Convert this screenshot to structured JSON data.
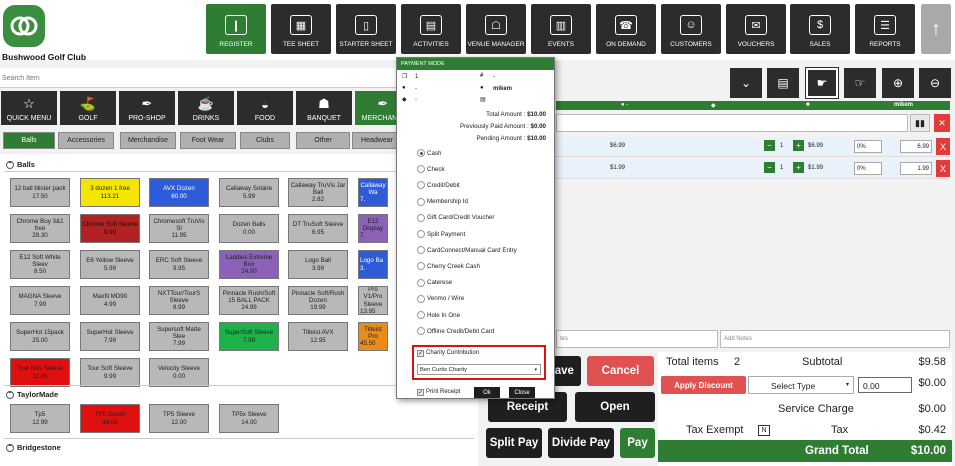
{
  "brand": {
    "name": "Bushwood Golf Club",
    "accent": "#2e7d32"
  },
  "nav": {
    "items": [
      {
        "label": "REGISTER",
        "icon": "barcode-scanner-icon",
        "active": true
      },
      {
        "label": "TEE SHEET",
        "icon": "tee-sheet-icon"
      },
      {
        "label": "STARTER SHEET",
        "icon": "tablet-icon"
      },
      {
        "label": "ACTIVITIES",
        "icon": "calendar-icon"
      },
      {
        "label": "VENUE MANAGER",
        "icon": "venue-icon"
      },
      {
        "label": "EVENTS",
        "icon": "events-calendar-icon"
      },
      {
        "label": "ON DEMAND",
        "icon": "phone-icon"
      },
      {
        "label": "CUSTOMERS",
        "icon": "customers-icon"
      },
      {
        "label": "VOUCHERS",
        "icon": "voucher-icon"
      },
      {
        "label": "SALES",
        "icon": "sales-icon"
      },
      {
        "label": "REPORTS",
        "icon": "reports-icon"
      }
    ]
  },
  "search": {
    "placeholder": "Search Item"
  },
  "categories": [
    {
      "label": "QUICK MENU",
      "icon": "star-icon"
    },
    {
      "label": "GOLF",
      "icon": "golf-icon"
    },
    {
      "label": "PRO-SHOP",
      "icon": "tag-icon"
    },
    {
      "label": "DRINKS",
      "icon": "drink-icon"
    },
    {
      "label": "FOOD",
      "icon": "burger-icon"
    },
    {
      "label": "BANQUET",
      "icon": "banquet-icon"
    },
    {
      "label": "MERCHANDI",
      "icon": "merch-icon",
      "active": true
    }
  ],
  "subcategories": [
    "Balls",
    "Accessories",
    "Merchandise",
    "Foot Wear",
    "Clubs",
    "Other",
    "Headwear"
  ],
  "sections": {
    "balls": "Balls",
    "taylormade": "TaylorMade",
    "bridgestone": "Bridgestone"
  },
  "products": {
    "balls": [
      {
        "name": "12 ball blister pack",
        "price": "17.50",
        "color": "g"
      },
      {
        "name": "3 dozen 1 free",
        "price": "113.21",
        "color": "y"
      },
      {
        "name": "AVX Dozen",
        "price": "60.00",
        "color": "b"
      },
      {
        "name": "Callaway Solaire",
        "price": "5.99",
        "color": "g"
      },
      {
        "name": "Callaway TruVis Jar Ball",
        "price": "2.82",
        "color": "g"
      },
      {
        "name": "Callaway Wa",
        "price": "7.",
        "color": "b"
      },
      {
        "name": "Chrome Buy 3&1 free",
        "price": "28.30",
        "color": "g"
      },
      {
        "name": "Chrome Soft Sleeve",
        "price": "9.99",
        "color": "dr"
      },
      {
        "name": "Chromesoft TruVis Sl",
        "price": "11.95",
        "color": "g"
      },
      {
        "name": "Dozen Balls",
        "price": "0.00",
        "color": "g"
      },
      {
        "name": "DT TruSoft Sleeve",
        "price": "6.95",
        "color": "g"
      },
      {
        "name": "E12 Display",
        "price": "7.",
        "color": "p"
      },
      {
        "name": "E12 Soft White Sleev",
        "price": "8.50",
        "color": "g"
      },
      {
        "name": "E6 Yellow Sleeve",
        "price": "5.99",
        "color": "g"
      },
      {
        "name": "ERC Soft Sleeve",
        "price": "9.95",
        "color": "g"
      },
      {
        "name": "Laddies Extreme Box",
        "price": "24.00",
        "color": "p"
      },
      {
        "name": "Logo Ball",
        "price": "3.99",
        "color": "g"
      },
      {
        "name": "Logo Ba",
        "price": "3.",
        "color": "b"
      },
      {
        "name": "MAGNA Sleeve",
        "price": "7.99",
        "color": "g"
      },
      {
        "name": "Maxfli MD90",
        "price": "4.99",
        "color": "g"
      },
      {
        "name": "NXTTour/TourS Sleeve",
        "price": "8.99",
        "color": "g"
      },
      {
        "name": "Pinnacle Rush/Soft 15 BALL PACK",
        "price": "24.99",
        "color": "g"
      },
      {
        "name": "Pinnacle Soft/Rush Dozen",
        "price": "19.99",
        "color": "g"
      },
      {
        "name": "Pro V1/Pro Sleeve",
        "price": "13.95",
        "color": "g"
      },
      {
        "name": "SuperHot 15pack",
        "price": "25.00",
        "color": "g"
      },
      {
        "name": "SuperHot Sleeve",
        "price": "7.99",
        "color": "g"
      },
      {
        "name": "Supersoft Matte Slee",
        "price": "7.99",
        "color": "g"
      },
      {
        "name": "SuperSoft Sleeve",
        "price": "7.99",
        "color": "gr"
      },
      {
        "name": "Titleist AVX",
        "price": "12.95",
        "color": "g"
      },
      {
        "name": "Titleist Pro",
        "price": "45.50",
        "color": "o"
      },
      {
        "name": "Tour BXs Sleeve",
        "price": "11.95",
        "color": "r"
      },
      {
        "name": "Tour Soft Sleeve",
        "price": "9.99",
        "color": "g"
      },
      {
        "name": "Velocity Sleeve",
        "price": "0.00",
        "color": "g"
      }
    ],
    "taylormade": [
      {
        "name": "Tp5",
        "price": "12.99",
        "color": "g"
      },
      {
        "name": "TP5 Dozen",
        "price": "48.00",
        "color": "r"
      },
      {
        "name": "TP5 Sleeve",
        "price": "12.00",
        "color": "g"
      },
      {
        "name": "TP5x Sleeve",
        "price": "14.00",
        "color": "g"
      }
    ]
  },
  "cart": {
    "header_user": "mikem",
    "rows": [
      {
        "price": "$6.99",
        "qty": "1",
        "unit": "$6.99",
        "disc": "0%",
        "total": "6.99"
      },
      {
        "price": "$1.99",
        "qty": "1",
        "unit": "$1.99",
        "disc": "0%",
        "total": "1.99"
      }
    ],
    "notes_placeholder": "Add Notes",
    "notes_left_placeholder": "tes"
  },
  "actions": {
    "save": "Save",
    "cancel": "Cancel",
    "receipt": "Receipt",
    "open": "Open",
    "split_pay": "Split Pay",
    "divide_pay": "Divide Pay",
    "pay": "Pay"
  },
  "totals": {
    "items_label": "Total items",
    "items_count": "2",
    "subtotal_label": "Subtotal",
    "subtotal": "$9.58",
    "apply_discount": "Apply Discount",
    "select_type": "Select Type",
    "discount_input": "0.00",
    "discount_value": "$0.00",
    "service_label": "Service Charge",
    "service_value": "$0.00",
    "tax_exempt_label": "Tax Exempt",
    "tax_exempt_key": "N",
    "tax_label": "Tax",
    "tax_value": "$0.42",
    "grand_label": "Grand Total",
    "grand_value": "$10.00"
  },
  "payment_modal": {
    "title": "PAYMENT MODE",
    "ticket_count": "1",
    "hash_value": "-",
    "user_value": "-",
    "user_name": "mikem",
    "tag_value": "-",
    "total_label": "Total Amount :",
    "total_value": "$10.00",
    "prev_label": "Previously Paid Amount :",
    "prev_value": "$0.00",
    "pending_label": "Pending Amount :",
    "pending_value": "$10.00",
    "options": [
      {
        "label": "Cash",
        "selected": true
      },
      {
        "label": "Check"
      },
      {
        "label": "Credit/Debit"
      },
      {
        "label": "Membership Id"
      },
      {
        "label": "Gift Card/Credit Voucher"
      },
      {
        "label": "Split Payment"
      },
      {
        "label": "CardConnect/Manual Card Entry"
      },
      {
        "label": "Cherry Creek Cash"
      },
      {
        "label": "Caterese"
      },
      {
        "label": "Venmo / Wire"
      },
      {
        "label": "Hole In One"
      },
      {
        "label": "Offline Credit/Debit Card"
      }
    ],
    "charity_label": "Charity Contribution",
    "charity_selected": "Ben Curtis Charity",
    "print_receipt_label": "Print Receipt",
    "ok_label": "Ok",
    "close_label": "Close"
  }
}
